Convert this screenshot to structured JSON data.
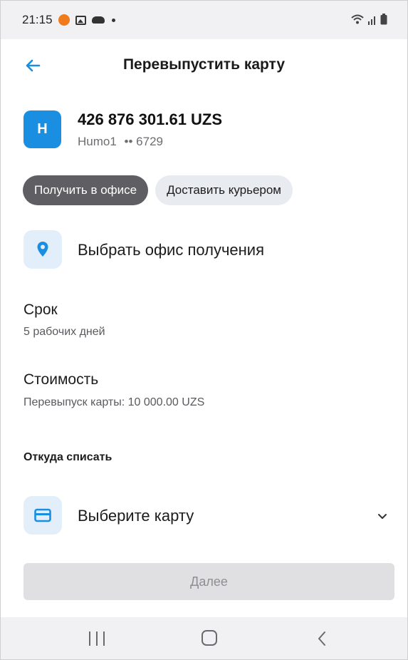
{
  "status_bar": {
    "time": "21:15",
    "icons": [
      "notification-icon",
      "gallery-icon",
      "cloud-icon",
      "dot-icon",
      "wifi-icon",
      "signal-icon",
      "battery-icon"
    ]
  },
  "header": {
    "title": "Перевыпустить карту",
    "back_icon": "arrow-left-icon"
  },
  "card": {
    "logo_letter": "H",
    "amount": "426 876 301.61 UZS",
    "name": "Humo1",
    "masked_number": "•• 6729"
  },
  "delivery_options": {
    "selected": "Получить в офисе",
    "options": [
      {
        "label": "Получить в офисе",
        "active": true
      },
      {
        "label": "Доставить курьером",
        "active": false
      }
    ]
  },
  "office": {
    "label": "Выбрать офис получения",
    "icon": "location-pin-icon"
  },
  "term": {
    "title": "Срок",
    "value": "5 рабочих дней"
  },
  "cost": {
    "title": "Стоимость",
    "value": "Перевыпуск карты: 10 000.00 UZS"
  },
  "source": {
    "title": "Откуда списать",
    "select_label": "Выберите карту",
    "icon": "credit-card-icon"
  },
  "next_button": {
    "label": "Далее",
    "enabled": false
  },
  "nav_bar": {
    "icons": [
      "recents-icon",
      "home-icon",
      "back-icon"
    ]
  },
  "colors": {
    "accent": "#1a8ee0",
    "chip_active": "#5f5f63",
    "chip_inactive": "#e8ebef",
    "icon_bg": "#e2effa",
    "disabled_button": "#e0e0e2"
  }
}
